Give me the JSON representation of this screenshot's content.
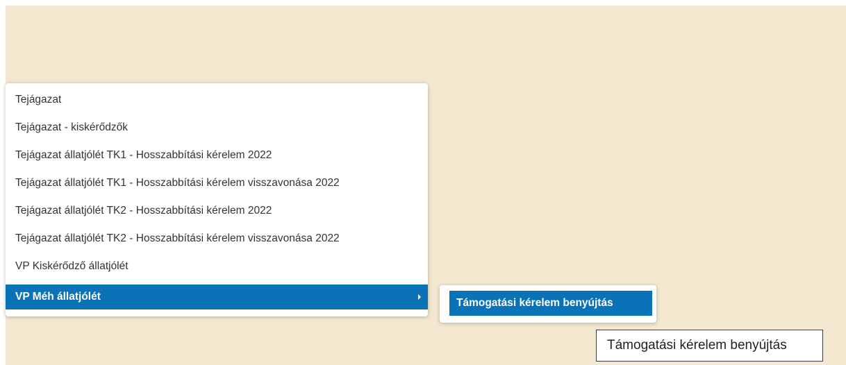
{
  "menu": {
    "items": [
      {
        "label": "Tejágazat"
      },
      {
        "label": "Tejágazat - kiskérődzők"
      },
      {
        "label": "Tejágazat állatjólét TK1 - Hosszabbítási kérelem 2022"
      },
      {
        "label": "Tejágazat állatjólét TK1 - Hosszabbítási kérelem visszavonása 2022"
      },
      {
        "label": "Tejágazat állatjólét TK2 - Hosszabbítási kérelem 2022"
      },
      {
        "label": "Tejágazat állatjólét TK2 - Hosszabbítási kérelem visszavonása 2022"
      },
      {
        "label": "VP Kiskérődző állatjólét"
      },
      {
        "label": "VP Méh állatjólét",
        "active": true,
        "has_submenu": true,
        "submenu_icon": "chevron-right-icon"
      }
    ]
  },
  "submenu": {
    "items": [
      {
        "label": "Támogatási kérelem benyújtás",
        "active": true
      }
    ]
  },
  "tooltip": {
    "text": "Támogatási kérelem benyújtás"
  },
  "colors": {
    "background": "#f3e8cf",
    "highlight": "#0a73b8",
    "text": "#333333"
  }
}
